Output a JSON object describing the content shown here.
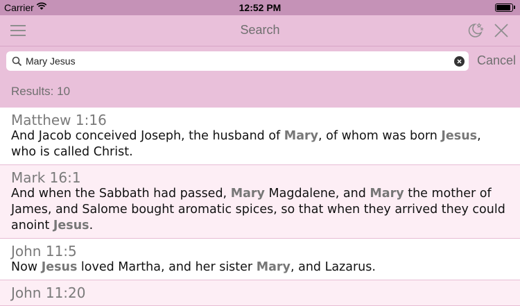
{
  "status": {
    "carrier": "Carrier",
    "time": "12:52 PM",
    "battery_level": 1.0
  },
  "nav": {
    "title": "Search",
    "icons": [
      "menu-icon",
      "night-mode-icon",
      "close-icon"
    ]
  },
  "search": {
    "query": "Mary Jesus",
    "cancel_label": "Cancel"
  },
  "results_label": "Results: 10",
  "results": [
    {
      "ref": "Matthew 1:16",
      "segments": [
        [
          "And Jacob conceived Joseph, the husband of ",
          false
        ],
        [
          "Mary",
          true
        ],
        [
          ", of whom was born ",
          false
        ],
        [
          "Jesus",
          true
        ],
        [
          ", who is called Christ.",
          false
        ]
      ]
    },
    {
      "ref": "Mark 16:1",
      "segments": [
        [
          "And when the Sabbath had passed, ",
          false
        ],
        [
          "Mary",
          true
        ],
        [
          " Magdalene, and ",
          false
        ],
        [
          "Mary",
          true
        ],
        [
          " the mother of James, and Salome bought aromatic spices, so that when they arrived they could anoint ",
          false
        ],
        [
          "Jesus",
          true
        ],
        [
          ".",
          false
        ]
      ]
    },
    {
      "ref": "John 11:5",
      "segments": [
        [
          "Now ",
          false
        ],
        [
          "Jesus",
          true
        ],
        [
          " loved Martha, and her sister ",
          false
        ],
        [
          "Mary",
          true
        ],
        [
          ", and Lazarus.",
          false
        ]
      ]
    },
    {
      "ref": "John 11:20",
      "segments": []
    }
  ],
  "colors": {
    "bar": "#e9c0da",
    "status": "#c592b7",
    "highlight": "#777777"
  }
}
